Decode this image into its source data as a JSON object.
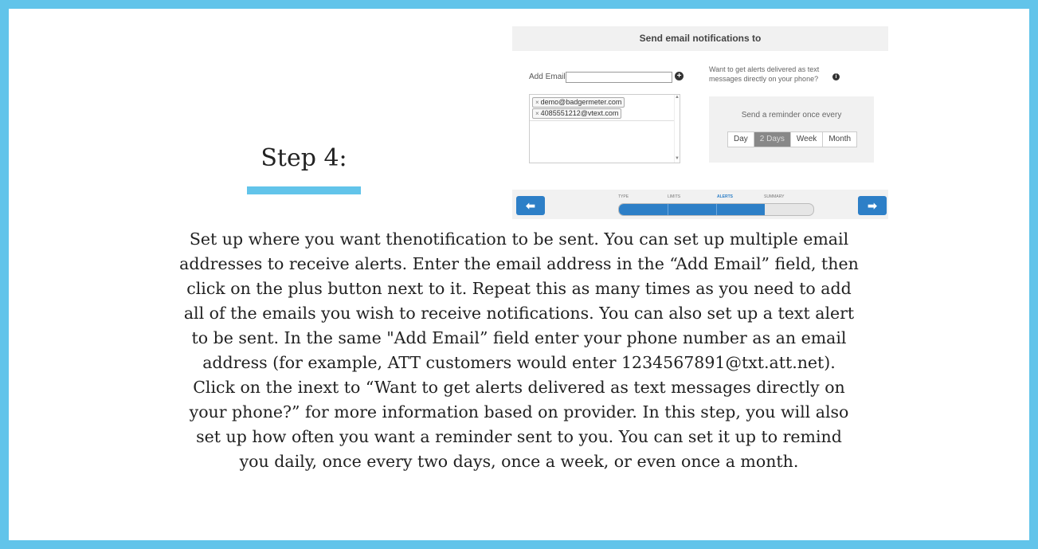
{
  "step": {
    "title": "Step 4:"
  },
  "app": {
    "header_title": "Send email notifications to",
    "add_email_label": "Add Email:",
    "add_email_value": "",
    "add_icon": "plus-circle",
    "emails": [
      "demo@badgermeter.com",
      "4085551212@vtext.com"
    ],
    "remove_glyph": "×",
    "sms_prompt": "Want to get alerts delivered as text messages directly on your phone?",
    "info_icon": "info-circle",
    "reminder_label": "Send a reminder once every",
    "frequency_options": [
      "Day",
      "2 Days",
      "Week",
      "Month"
    ],
    "frequency_selected": "2 Days",
    "wizard_steps": [
      "TYPE",
      "LIMITS",
      "ALERTS",
      "SUMMARY"
    ],
    "wizard_active": "ALERTS",
    "wizard_progress": 0.75,
    "prev_icon": "arrow-left",
    "next_icon": "arrow-right",
    "accent_color": "#2d7fc7"
  },
  "description": {
    "lines": [
      "Set up where you want thenotification to be sent. You can set up multiple email",
      "addresses to receive alerts. Enter the email address in the “Add Email” field, then",
      "click on the plus button next to it. Repeat this as many times as you need to add",
      "all of the emails you wish to receive notifications. You can also set up a text alert",
      "to be sent. In the same \"Add Email” field enter your phone number as an email",
      "address (for example, ATT customers would enter 1234567891@txt.att.net).",
      "Click on the inext to “Want to get alerts delivered as text messages directly on",
      "your phone?” for more information based on provider. In this step, you will also",
      "set up how often you want a reminder sent to you. You can set it up to remind",
      "you daily, once every two days, once a week, or even once a month."
    ]
  },
  "colors": {
    "frame": "#62c4ea",
    "card": "#ffffff"
  }
}
